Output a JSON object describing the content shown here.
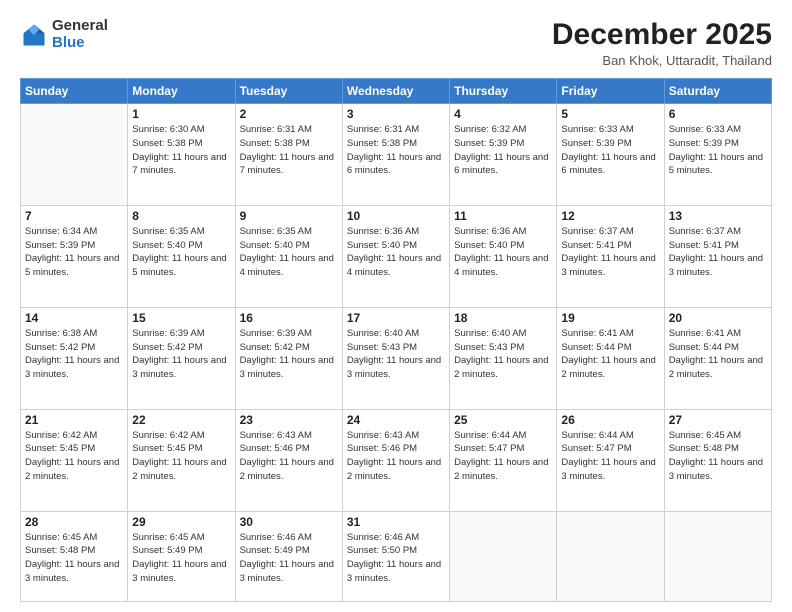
{
  "logo": {
    "general": "General",
    "blue": "Blue"
  },
  "header": {
    "month": "December 2025",
    "location": "Ban Khok, Uttaradit, Thailand"
  },
  "weekdays": [
    "Sunday",
    "Monday",
    "Tuesday",
    "Wednesday",
    "Thursday",
    "Friday",
    "Saturday"
  ],
  "weeks": [
    [
      {
        "day": null
      },
      {
        "day": 1,
        "sunrise": "Sunrise: 6:30 AM",
        "sunset": "Sunset: 5:38 PM",
        "daylight": "Daylight: 11 hours and 7 minutes."
      },
      {
        "day": 2,
        "sunrise": "Sunrise: 6:31 AM",
        "sunset": "Sunset: 5:38 PM",
        "daylight": "Daylight: 11 hours and 7 minutes."
      },
      {
        "day": 3,
        "sunrise": "Sunrise: 6:31 AM",
        "sunset": "Sunset: 5:38 PM",
        "daylight": "Daylight: 11 hours and 6 minutes."
      },
      {
        "day": 4,
        "sunrise": "Sunrise: 6:32 AM",
        "sunset": "Sunset: 5:39 PM",
        "daylight": "Daylight: 11 hours and 6 minutes."
      },
      {
        "day": 5,
        "sunrise": "Sunrise: 6:33 AM",
        "sunset": "Sunset: 5:39 PM",
        "daylight": "Daylight: 11 hours and 6 minutes."
      },
      {
        "day": 6,
        "sunrise": "Sunrise: 6:33 AM",
        "sunset": "Sunset: 5:39 PM",
        "daylight": "Daylight: 11 hours and 5 minutes."
      }
    ],
    [
      {
        "day": 7,
        "sunrise": "Sunrise: 6:34 AM",
        "sunset": "Sunset: 5:39 PM",
        "daylight": "Daylight: 11 hours and 5 minutes."
      },
      {
        "day": 8,
        "sunrise": "Sunrise: 6:35 AM",
        "sunset": "Sunset: 5:40 PM",
        "daylight": "Daylight: 11 hours and 5 minutes."
      },
      {
        "day": 9,
        "sunrise": "Sunrise: 6:35 AM",
        "sunset": "Sunset: 5:40 PM",
        "daylight": "Daylight: 11 hours and 4 minutes."
      },
      {
        "day": 10,
        "sunrise": "Sunrise: 6:36 AM",
        "sunset": "Sunset: 5:40 PM",
        "daylight": "Daylight: 11 hours and 4 minutes."
      },
      {
        "day": 11,
        "sunrise": "Sunrise: 6:36 AM",
        "sunset": "Sunset: 5:40 PM",
        "daylight": "Daylight: 11 hours and 4 minutes."
      },
      {
        "day": 12,
        "sunrise": "Sunrise: 6:37 AM",
        "sunset": "Sunset: 5:41 PM",
        "daylight": "Daylight: 11 hours and 3 minutes."
      },
      {
        "day": 13,
        "sunrise": "Sunrise: 6:37 AM",
        "sunset": "Sunset: 5:41 PM",
        "daylight": "Daylight: 11 hours and 3 minutes."
      }
    ],
    [
      {
        "day": 14,
        "sunrise": "Sunrise: 6:38 AM",
        "sunset": "Sunset: 5:42 PM",
        "daylight": "Daylight: 11 hours and 3 minutes."
      },
      {
        "day": 15,
        "sunrise": "Sunrise: 6:39 AM",
        "sunset": "Sunset: 5:42 PM",
        "daylight": "Daylight: 11 hours and 3 minutes."
      },
      {
        "day": 16,
        "sunrise": "Sunrise: 6:39 AM",
        "sunset": "Sunset: 5:42 PM",
        "daylight": "Daylight: 11 hours and 3 minutes."
      },
      {
        "day": 17,
        "sunrise": "Sunrise: 6:40 AM",
        "sunset": "Sunset: 5:43 PM",
        "daylight": "Daylight: 11 hours and 3 minutes."
      },
      {
        "day": 18,
        "sunrise": "Sunrise: 6:40 AM",
        "sunset": "Sunset: 5:43 PM",
        "daylight": "Daylight: 11 hours and 2 minutes."
      },
      {
        "day": 19,
        "sunrise": "Sunrise: 6:41 AM",
        "sunset": "Sunset: 5:44 PM",
        "daylight": "Daylight: 11 hours and 2 minutes."
      },
      {
        "day": 20,
        "sunrise": "Sunrise: 6:41 AM",
        "sunset": "Sunset: 5:44 PM",
        "daylight": "Daylight: 11 hours and 2 minutes."
      }
    ],
    [
      {
        "day": 21,
        "sunrise": "Sunrise: 6:42 AM",
        "sunset": "Sunset: 5:45 PM",
        "daylight": "Daylight: 11 hours and 2 minutes."
      },
      {
        "day": 22,
        "sunrise": "Sunrise: 6:42 AM",
        "sunset": "Sunset: 5:45 PM",
        "daylight": "Daylight: 11 hours and 2 minutes."
      },
      {
        "day": 23,
        "sunrise": "Sunrise: 6:43 AM",
        "sunset": "Sunset: 5:46 PM",
        "daylight": "Daylight: 11 hours and 2 minutes."
      },
      {
        "day": 24,
        "sunrise": "Sunrise: 6:43 AM",
        "sunset": "Sunset: 5:46 PM",
        "daylight": "Daylight: 11 hours and 2 minutes."
      },
      {
        "day": 25,
        "sunrise": "Sunrise: 6:44 AM",
        "sunset": "Sunset: 5:47 PM",
        "daylight": "Daylight: 11 hours and 2 minutes."
      },
      {
        "day": 26,
        "sunrise": "Sunrise: 6:44 AM",
        "sunset": "Sunset: 5:47 PM",
        "daylight": "Daylight: 11 hours and 3 minutes."
      },
      {
        "day": 27,
        "sunrise": "Sunrise: 6:45 AM",
        "sunset": "Sunset: 5:48 PM",
        "daylight": "Daylight: 11 hours and 3 minutes."
      }
    ],
    [
      {
        "day": 28,
        "sunrise": "Sunrise: 6:45 AM",
        "sunset": "Sunset: 5:48 PM",
        "daylight": "Daylight: 11 hours and 3 minutes."
      },
      {
        "day": 29,
        "sunrise": "Sunrise: 6:45 AM",
        "sunset": "Sunset: 5:49 PM",
        "daylight": "Daylight: 11 hours and 3 minutes."
      },
      {
        "day": 30,
        "sunrise": "Sunrise: 6:46 AM",
        "sunset": "Sunset: 5:49 PM",
        "daylight": "Daylight: 11 hours and 3 minutes."
      },
      {
        "day": 31,
        "sunrise": "Sunrise: 6:46 AM",
        "sunset": "Sunset: 5:50 PM",
        "daylight": "Daylight: 11 hours and 3 minutes."
      },
      {
        "day": null
      },
      {
        "day": null
      },
      {
        "day": null
      }
    ]
  ]
}
